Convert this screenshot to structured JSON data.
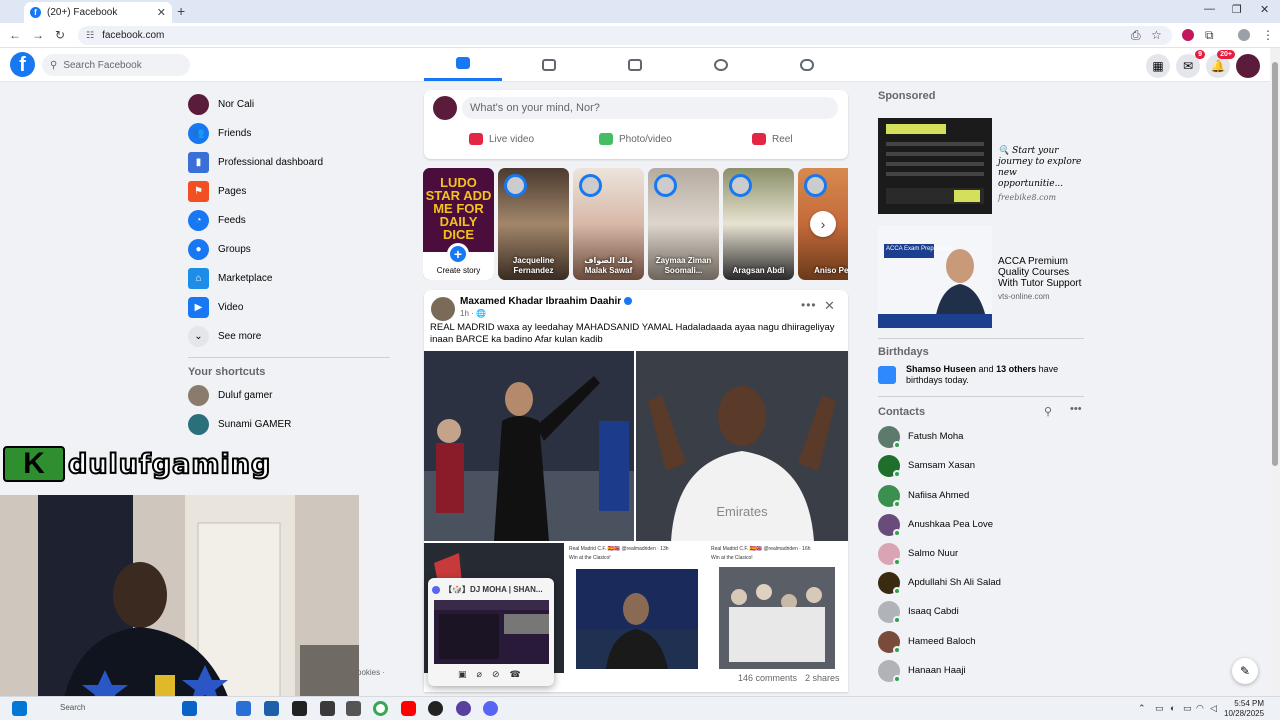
{
  "browser": {
    "tab_title": "(20+) Facebook",
    "url": "facebook.com"
  },
  "fb": {
    "search_placeholder": "Search Facebook",
    "notif_badge": "20+",
    "messenger_badge": "9"
  },
  "left_nav": {
    "items": [
      {
        "label": "Nor Cali",
        "icon": "profile-avatar"
      },
      {
        "label": "Friends",
        "icon": "friends-icon"
      },
      {
        "label": "Professional dashboard",
        "icon": "dashboard-icon"
      },
      {
        "label": "Pages",
        "icon": "flag-icon"
      },
      {
        "label": "Feeds",
        "icon": "feeds-icon"
      },
      {
        "label": "Groups",
        "icon": "groups-icon"
      },
      {
        "label": "Marketplace",
        "icon": "marketplace-icon"
      },
      {
        "label": "Video",
        "icon": "video-icon"
      },
      {
        "label": "See more",
        "icon": "chevron-down-icon"
      }
    ],
    "shortcuts_heading": "Your shortcuts",
    "shortcuts": [
      {
        "label": "Duluf gamer"
      },
      {
        "label": "Sunami GAMER"
      }
    ]
  },
  "overlay": {
    "stream_name": "dulufgaming",
    "cookies": "ookies ·"
  },
  "composer": {
    "placeholder": "What's on your mind, Nor?",
    "actions": [
      {
        "label": "Live video",
        "color": "#e42645"
      },
      {
        "label": "Photo/video",
        "color": "#45bd62"
      },
      {
        "label": "Reel",
        "color": "#e42645"
      }
    ]
  },
  "stories": {
    "create_label": "Create story",
    "create_banner": "LUDO STAR ADD ME FOR DAILY DICE",
    "items": [
      {
        "name": "Jacqueline Fernandez"
      },
      {
        "name": "ملك الصواف Malak Sawaf"
      },
      {
        "name": "Zaymaa Ziman Soomali..."
      },
      {
        "name": "Aragsan Abdi"
      },
      {
        "name": "Aniso Pea"
      }
    ]
  },
  "post": {
    "author": "Maxamed Khadar Ibraahim Daahir",
    "time": "1h · 🌐",
    "text": "REAL MADRID waxa ay leedahay MAHADSANID YAMAL Hadaladaada ayaa nagu dhiirageliyay inaan BARCE ka badino Afar kulan kadib",
    "comments": "146 comments",
    "shares": "2 shares",
    "embed1_header": "Real Madrid C.F. 🇪🇸🇬🇧 @realmadriden · 13h",
    "embed1_caption": "Win at the Clasico!",
    "embed2_header": "Real Madrid C.F. 🇪🇸🇬🇧 @realmadriden · 16h",
    "embed2_caption": "Win at the Clasico!"
  },
  "miniplayer": {
    "title": "【🎲】DJ MOHA | SHAN..."
  },
  "right": {
    "sponsored": "Sponsored",
    "ads": [
      {
        "title": "🔍 Start your journey to explore new opportunitie...",
        "url": "freebike8.com"
      },
      {
        "title": "ACCA Premium Quality Courses With Tutor Support",
        "url": "vts-online.com",
        "img_title": "ACCA Exam Preparation"
      }
    ],
    "birthdays_heading": "Birthdays",
    "birthday_name": "Shamso Huseen",
    "birthday_mid": " and ",
    "birthday_others": "13 others",
    "birthday_tail": " have birthdays today.",
    "contacts_heading": "Contacts",
    "contacts": [
      {
        "name": "Fatush Moha",
        "color": "#5d7b6a"
      },
      {
        "name": "Samsam Xasan",
        "color": "#1f6e2c"
      },
      {
        "name": "Nafiisa Ahmed",
        "color": "#3b8f4f"
      },
      {
        "name": "Anushkaa Pea Love",
        "color": "#6a4c7a"
      },
      {
        "name": "Salmo Nuur",
        "color": "#d9a4b4"
      },
      {
        "name": "Apdullahi Sh Ali Salad",
        "color": "#3a2a10"
      },
      {
        "name": "Isaaq Cabdi",
        "color": "#b0b3b8"
      },
      {
        "name": "Hameed Baloch",
        "color": "#7a4a3a"
      },
      {
        "name": "Hanaan Haaji",
        "color": "#b0b3b8"
      }
    ]
  },
  "taskbar": {
    "search": "Search",
    "time": "5:54 PM",
    "date": "10/28/2025"
  }
}
